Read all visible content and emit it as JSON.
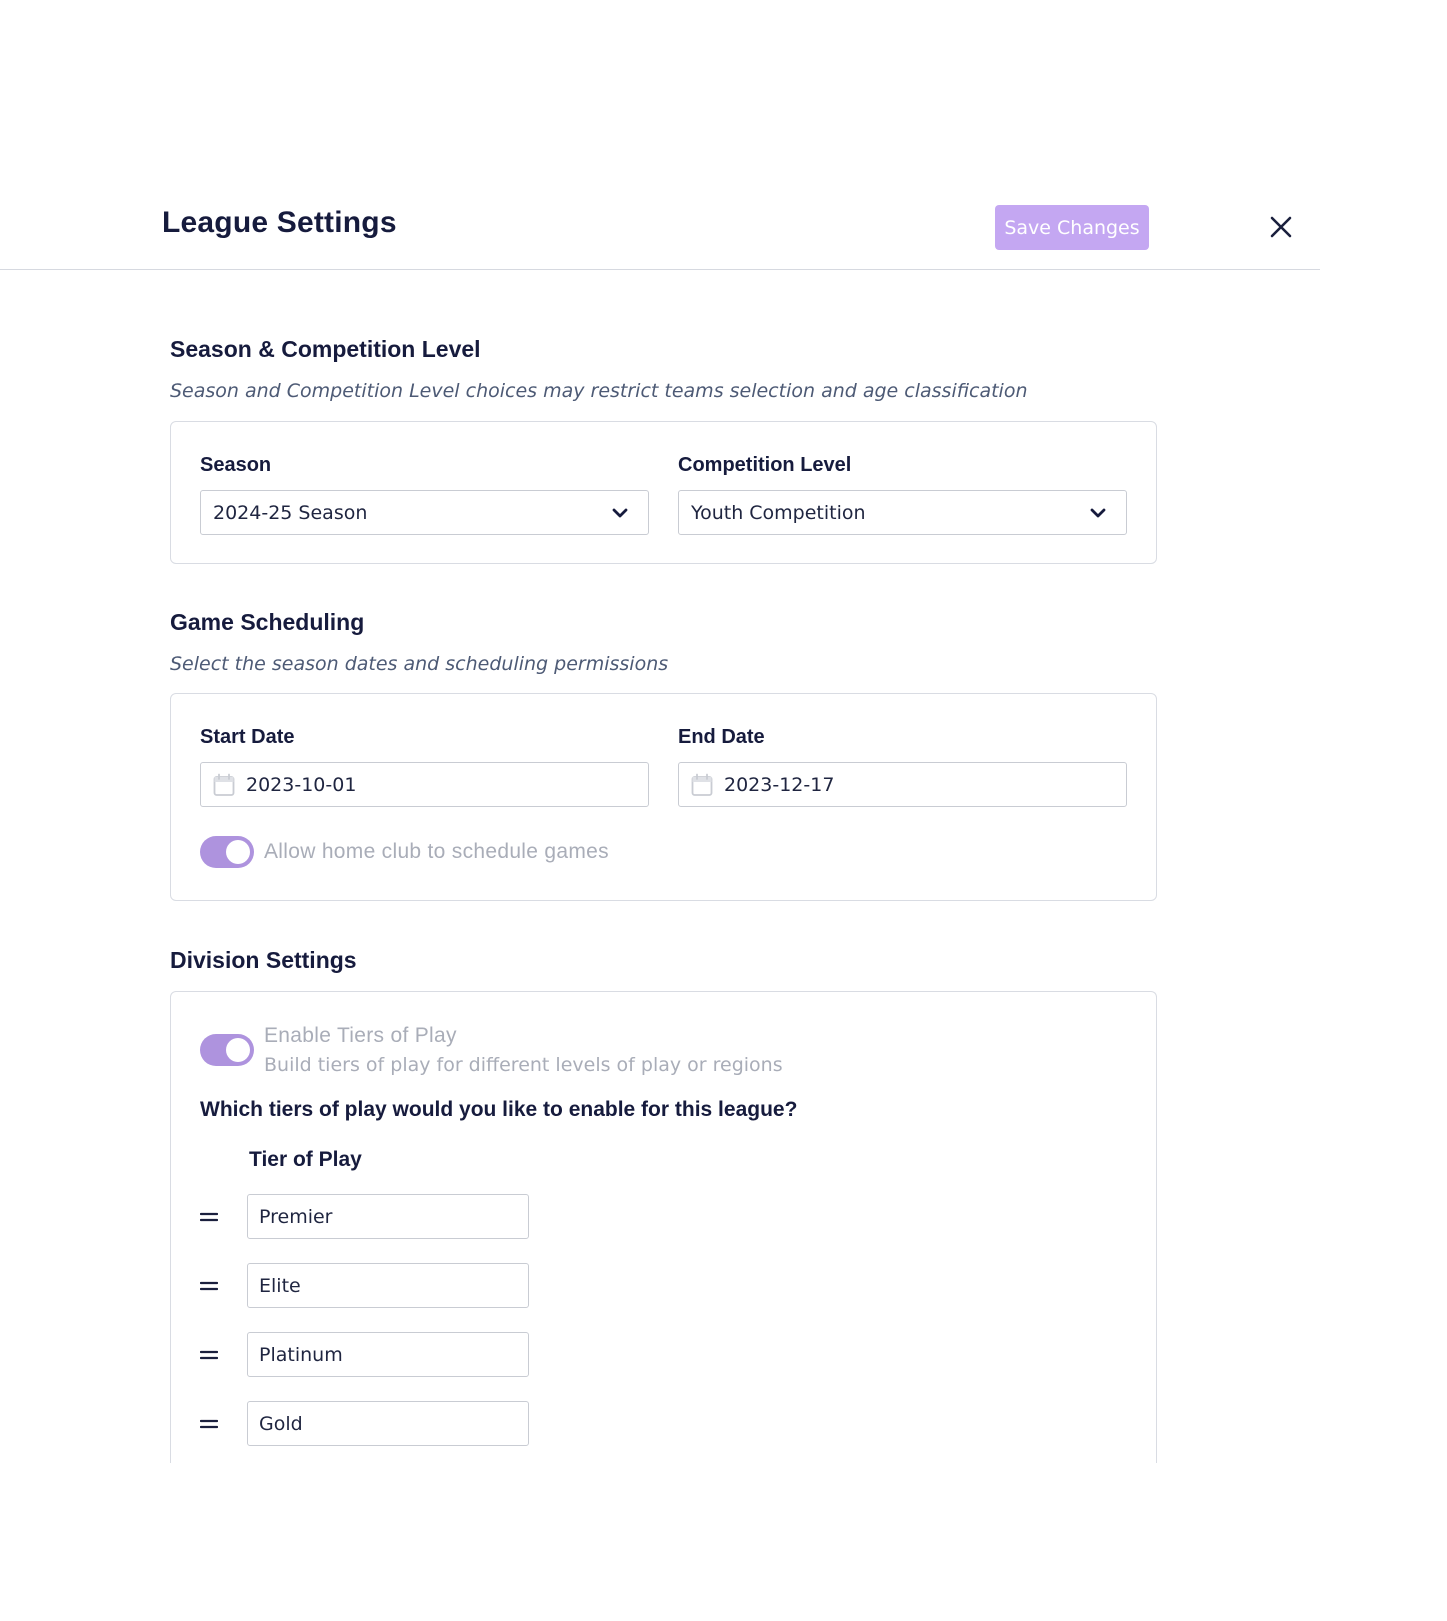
{
  "header": {
    "title": "League Settings",
    "save_label": "Save Changes",
    "close_icon": "close-icon"
  },
  "season_section": {
    "title": "Season & Competition Level",
    "subtitle": "Season and Competition Level choices may restrict teams selection and age classification",
    "season": {
      "label": "Season",
      "value": "2024-25 Season"
    },
    "competition": {
      "label": "Competition Level",
      "value": "Youth Competition"
    }
  },
  "scheduling_section": {
    "title": "Game Scheduling",
    "subtitle": "Select the season dates and scheduling permissions",
    "start_date": {
      "label": "Start Date",
      "value": "2023-10-01"
    },
    "end_date": {
      "label": "End Date",
      "value": "2023-12-17"
    },
    "home_club_toggle": {
      "label": "Allow home club to schedule games",
      "on": true
    }
  },
  "division_section": {
    "title": "Division Settings",
    "tiers_toggle": {
      "label": "Enable Tiers of Play",
      "description": "Build tiers of play for different levels of play or regions",
      "on": true
    },
    "question": "Which tiers of play would you like to enable for this league?",
    "tier_header": "Tier of Play",
    "tiers": [
      "Premier",
      "Elite",
      "Platinum",
      "Gold"
    ]
  },
  "colors": {
    "accent": "#c4a7f2",
    "toggle_on": "#ae93de",
    "heading": "#161b3d",
    "muted": "#a9adb8"
  }
}
